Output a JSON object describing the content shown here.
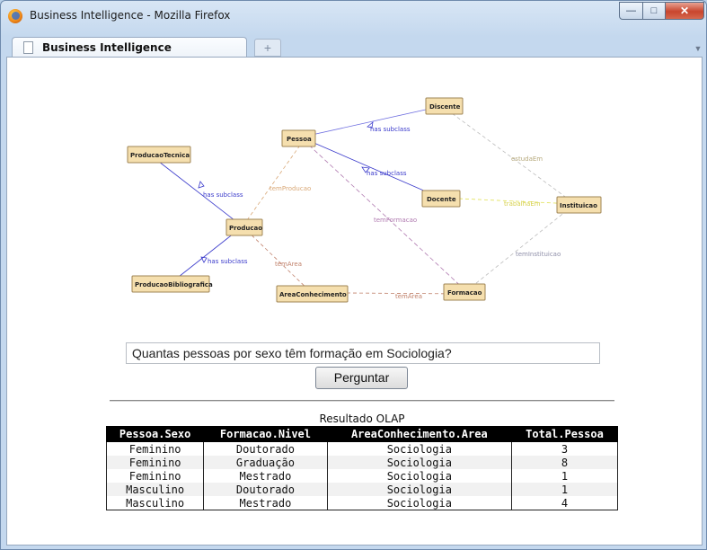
{
  "window": {
    "title": "Business Intelligence - Mozilla Firefox"
  },
  "tabs": [
    {
      "label": "Business Intelligence"
    }
  ],
  "graph": {
    "nodes": {
      "discente": "Discente",
      "pessoa": "Pessoa",
      "producao_tecnica": "ProducaoTecnica",
      "docente": "Docente",
      "instituicao": "Instituicao",
      "producao": "Producao",
      "producao_bibliografica": "ProducaoBibliografica",
      "area_conhecimento": "AreaConhecimento",
      "formacao": "Formacao"
    },
    "edge_labels": {
      "pessoa_discente": "has subclass",
      "pessoa_docente": "has subclass",
      "producao_tecnica": "has subclass",
      "producao_bibliografica": "has subclass",
      "estuda_em": "estudaEm",
      "tem_producao": "temProducao",
      "tem_formacao": "temFormacao",
      "trabalha_em": "trabalhaEm",
      "tem_area_1": "temArea",
      "tem_area_2": "temArea",
      "tem_instituicao": "temInstituicao"
    },
    "colors": {
      "node_fill": "#f5dfae",
      "subclass": "#3a3acb",
      "tem_formacao": "#b07ab0",
      "trabalha_em": "#e0e050",
      "tem_area": "#c0806a"
    }
  },
  "query": {
    "input_value": "Quantas pessoas por sexo têm formação em Sociologia?",
    "button_label": "Perguntar"
  },
  "result": {
    "caption": "Resultado OLAP",
    "columns": [
      "Pessoa.Sexo",
      "Formacao.Nivel",
      "AreaConhecimento.Area",
      "Total.Pessoa"
    ],
    "rows": [
      [
        "Feminino",
        "Doutorado",
        "Sociologia",
        "3"
      ],
      [
        "Feminino",
        "Graduação",
        "Sociologia",
        "8"
      ],
      [
        "Feminino",
        "Mestrado",
        "Sociologia",
        "1"
      ],
      [
        "Masculino",
        "Doutorado",
        "Sociologia",
        "1"
      ],
      [
        "Masculino",
        "Mestrado",
        "Sociologia",
        "4"
      ]
    ]
  }
}
